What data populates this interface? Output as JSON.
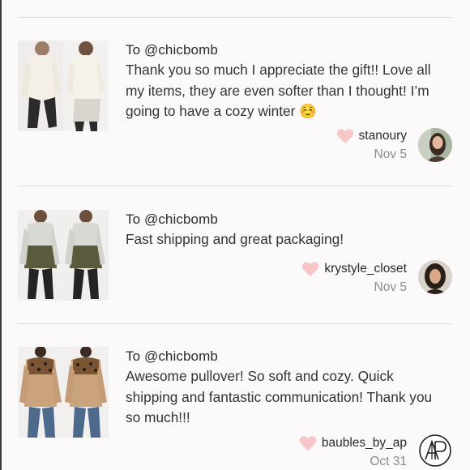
{
  "reviews": [
    {
      "to": "To @chicbomb",
      "message": "Thank you so much I appreciate the gift!! Love all my items, they are even softer than I thought! I’m going to have a cozy winter ☺️",
      "username": "stanoury",
      "date": "Nov 5",
      "thumb_icon": "cream-sweaters-photo",
      "avatar_icon": "stanoury-avatar"
    },
    {
      "to": "To @chicbomb",
      "message": "Fast shipping and great packaging!",
      "username": "krystyle_closet",
      "date": "Nov 5",
      "thumb_icon": "olive-fleece-pullover-photo",
      "avatar_icon": "krystyle-avatar"
    },
    {
      "to": "To @chicbomb",
      "message": "Awesome pullover! So soft and cozy. Quick shipping and fantastic communication! Thank you so much!!!",
      "username": "baubles_by_ap",
      "date": "Oct 31",
      "thumb_icon": "leopard-sherpa-pullover-photo",
      "avatar_icon": "ap-monogram-logo"
    }
  ],
  "colors": {
    "heart": "#f6c6c8",
    "background": "#fbf9f9",
    "divider": "#dcdcdc",
    "date": "#8d8d8d"
  }
}
